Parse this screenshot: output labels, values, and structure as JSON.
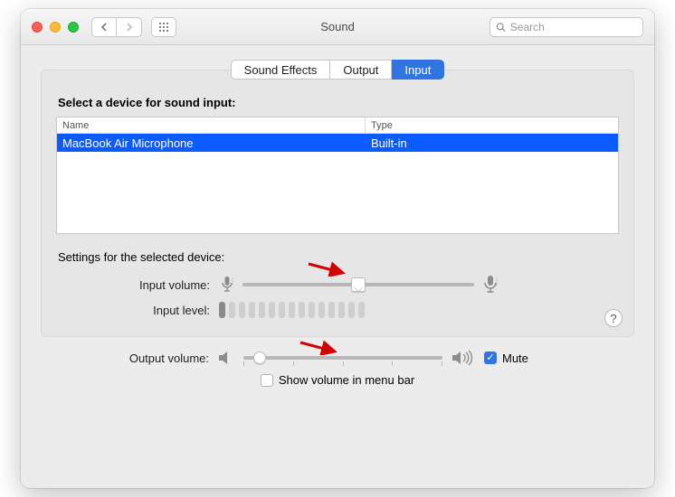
{
  "window": {
    "title": "Sound",
    "search_placeholder": "Search"
  },
  "tabs": {
    "sound_effects": "Sound Effects",
    "output": "Output",
    "input": "Input"
  },
  "panel": {
    "heading": "Select a device for sound input:",
    "col_name": "Name",
    "col_type": "Type",
    "row": {
      "name": "MacBook Air Microphone",
      "type": "Built-in"
    },
    "settings_label": "Settings for the selected device:",
    "input_volume_label": "Input volume:",
    "input_volume_percent": 50,
    "input_level_label": "Input level:",
    "input_level_active_bars": 1,
    "input_level_total_bars": 15,
    "help": "?"
  },
  "bottom": {
    "output_volume_label": "Output volume:",
    "output_volume_percent": 8,
    "mute_label": "Mute",
    "mute_checked": true,
    "menubar_label": "Show volume in menu bar",
    "menubar_checked": false
  }
}
